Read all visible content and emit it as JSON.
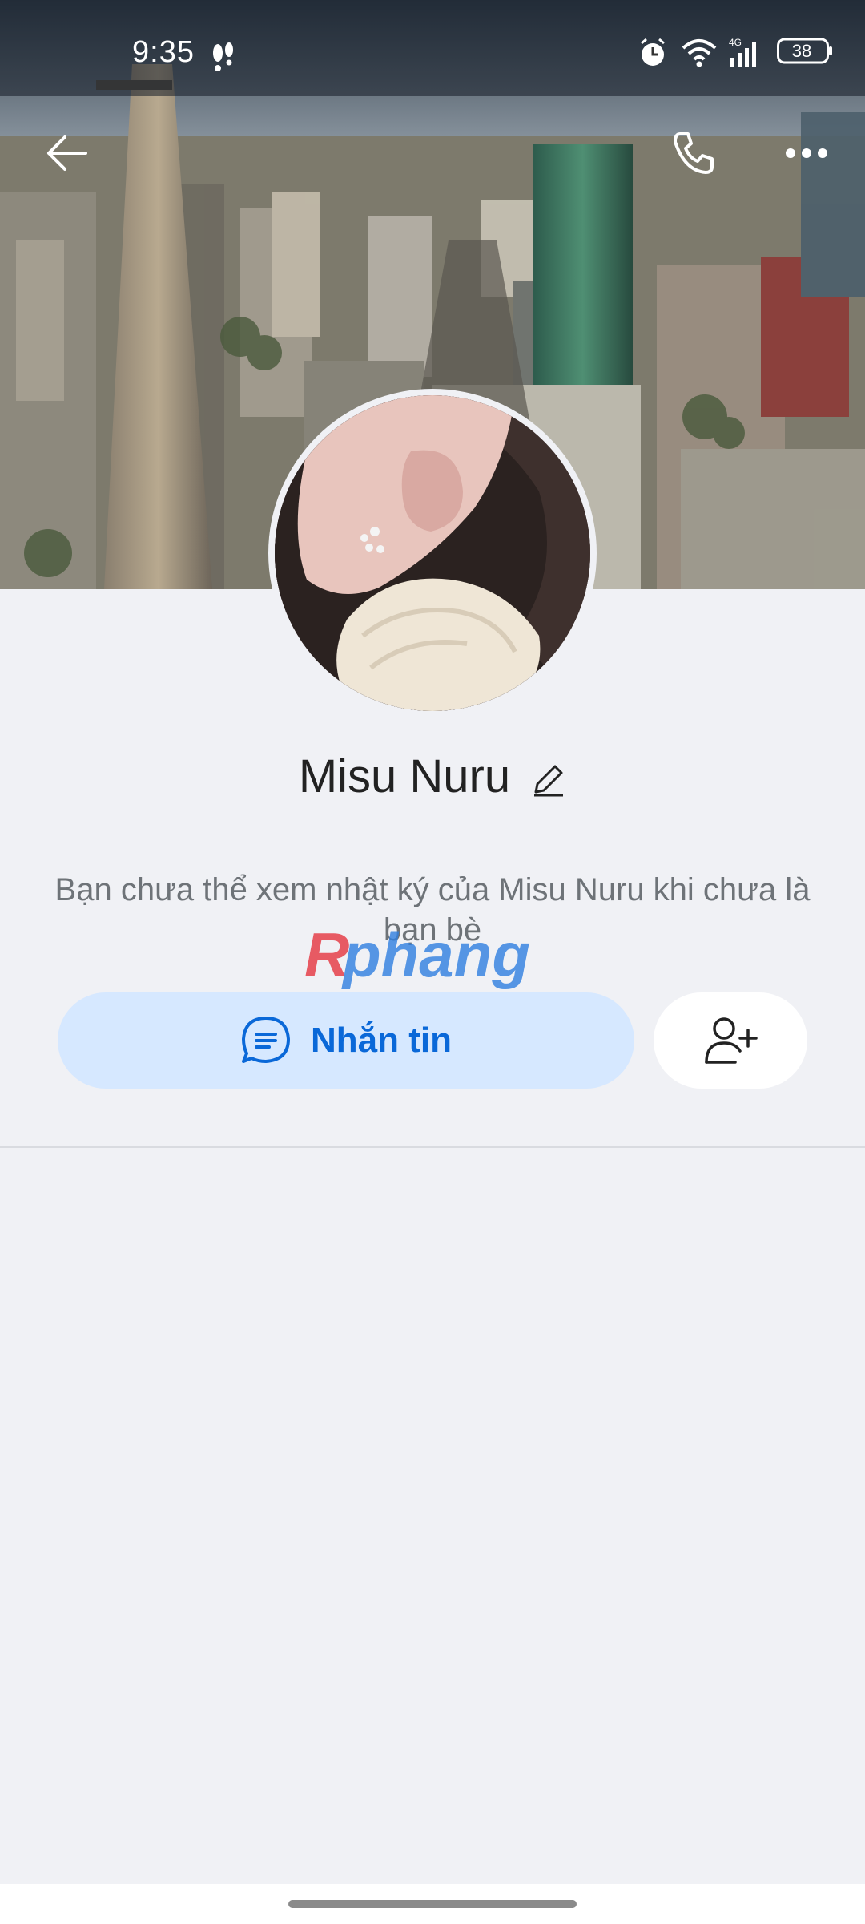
{
  "status_bar": {
    "time": "9:35",
    "battery": "38",
    "network": "4G"
  },
  "top_nav": {
    "back_icon": "arrow-left-icon",
    "call_icon": "phone-icon",
    "more_icon": "more-dots-icon"
  },
  "profile": {
    "name": "Misu Nuru",
    "privacy_note": "Bạn chưa thể xem nhật ký của Misu Nuru khi chưa là bạn bè"
  },
  "actions": {
    "message_label": "Nhắn tin",
    "message_icon": "chat-bubble-icon",
    "add_friend_icon": "add-friend-icon"
  },
  "watermark": {
    "text": "Rphang"
  },
  "colors": {
    "background": "#f0f1f5",
    "primary_blue": "#0a68d8",
    "message_button_bg": "#d6e8ff",
    "watermark_red": "#e6404a",
    "watermark_blue": "#2f7fe0"
  }
}
